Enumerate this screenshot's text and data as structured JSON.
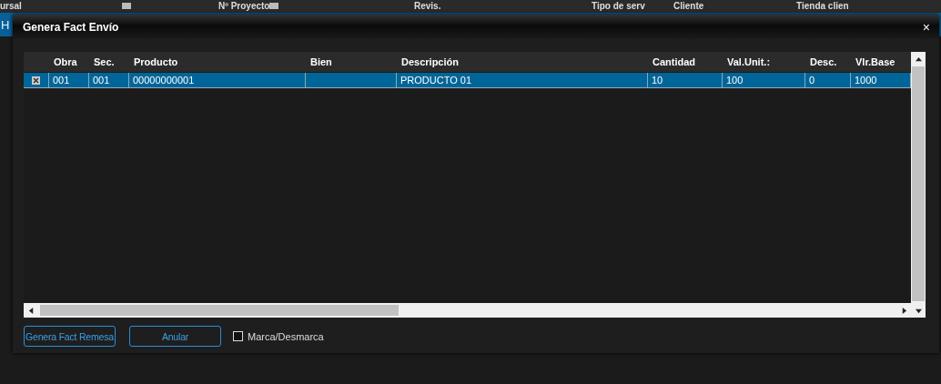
{
  "background": {
    "headers": [
      {
        "label": "ursal"
      },
      {
        "label": "Nº Proyecto"
      },
      {
        "label": "Revis."
      },
      {
        "label": "Tipo de serv"
      },
      {
        "label": "Cliente"
      },
      {
        "label": "Tienda clien"
      }
    ],
    "band_text": "H"
  },
  "dialog": {
    "title": "Genera Fact Envío",
    "close": "×"
  },
  "table": {
    "columns": [
      "Obra",
      "Sec.",
      "Producto",
      "Bien",
      "Descripción",
      "Cantidad",
      "Val.Unit.:",
      "Desc.",
      "Vlr.Base"
    ],
    "rows": [
      {
        "checked": true,
        "selected": true,
        "cells": [
          "001",
          "001",
          "00000000001",
          "",
          "PRODUCTO 01",
          "10",
          "100",
          "0",
          "1000"
        ]
      }
    ]
  },
  "buttons": [
    "Genera Fact Remesa",
    "Anular"
  ],
  "toggle": {
    "label": "Marca/Desmarca",
    "checked": false
  }
}
